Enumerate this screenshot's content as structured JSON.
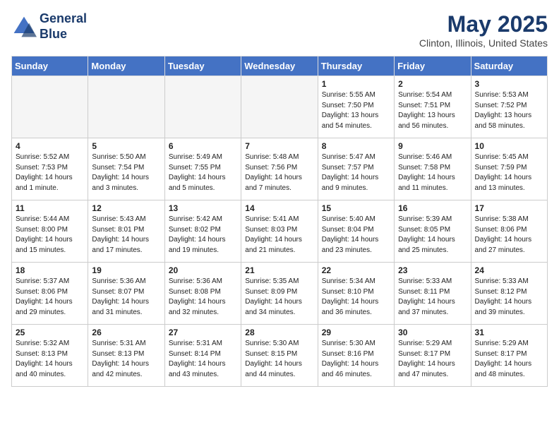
{
  "header": {
    "logo_line1": "General",
    "logo_line2": "Blue",
    "month_title": "May 2025",
    "location": "Clinton, Illinois, United States"
  },
  "days_of_week": [
    "Sunday",
    "Monday",
    "Tuesday",
    "Wednesday",
    "Thursday",
    "Friday",
    "Saturday"
  ],
  "weeks": [
    [
      {
        "day": "",
        "empty": true
      },
      {
        "day": "",
        "empty": true
      },
      {
        "day": "",
        "empty": true
      },
      {
        "day": "",
        "empty": true
      },
      {
        "day": "1",
        "sunrise": "Sunrise: 5:55 AM",
        "sunset": "Sunset: 7:50 PM",
        "daylight": "Daylight: 13 hours and 54 minutes."
      },
      {
        "day": "2",
        "sunrise": "Sunrise: 5:54 AM",
        "sunset": "Sunset: 7:51 PM",
        "daylight": "Daylight: 13 hours and 56 minutes."
      },
      {
        "day": "3",
        "sunrise": "Sunrise: 5:53 AM",
        "sunset": "Sunset: 7:52 PM",
        "daylight": "Daylight: 13 hours and 58 minutes."
      }
    ],
    [
      {
        "day": "4",
        "sunrise": "Sunrise: 5:52 AM",
        "sunset": "Sunset: 7:53 PM",
        "daylight": "Daylight: 14 hours and 1 minute."
      },
      {
        "day": "5",
        "sunrise": "Sunrise: 5:50 AM",
        "sunset": "Sunset: 7:54 PM",
        "daylight": "Daylight: 14 hours and 3 minutes."
      },
      {
        "day": "6",
        "sunrise": "Sunrise: 5:49 AM",
        "sunset": "Sunset: 7:55 PM",
        "daylight": "Daylight: 14 hours and 5 minutes."
      },
      {
        "day": "7",
        "sunrise": "Sunrise: 5:48 AM",
        "sunset": "Sunset: 7:56 PM",
        "daylight": "Daylight: 14 hours and 7 minutes."
      },
      {
        "day": "8",
        "sunrise": "Sunrise: 5:47 AM",
        "sunset": "Sunset: 7:57 PM",
        "daylight": "Daylight: 14 hours and 9 minutes."
      },
      {
        "day": "9",
        "sunrise": "Sunrise: 5:46 AM",
        "sunset": "Sunset: 7:58 PM",
        "daylight": "Daylight: 14 hours and 11 minutes."
      },
      {
        "day": "10",
        "sunrise": "Sunrise: 5:45 AM",
        "sunset": "Sunset: 7:59 PM",
        "daylight": "Daylight: 14 hours and 13 minutes."
      }
    ],
    [
      {
        "day": "11",
        "sunrise": "Sunrise: 5:44 AM",
        "sunset": "Sunset: 8:00 PM",
        "daylight": "Daylight: 14 hours and 15 minutes."
      },
      {
        "day": "12",
        "sunrise": "Sunrise: 5:43 AM",
        "sunset": "Sunset: 8:01 PM",
        "daylight": "Daylight: 14 hours and 17 minutes."
      },
      {
        "day": "13",
        "sunrise": "Sunrise: 5:42 AM",
        "sunset": "Sunset: 8:02 PM",
        "daylight": "Daylight: 14 hours and 19 minutes."
      },
      {
        "day": "14",
        "sunrise": "Sunrise: 5:41 AM",
        "sunset": "Sunset: 8:03 PM",
        "daylight": "Daylight: 14 hours and 21 minutes."
      },
      {
        "day": "15",
        "sunrise": "Sunrise: 5:40 AM",
        "sunset": "Sunset: 8:04 PM",
        "daylight": "Daylight: 14 hours and 23 minutes."
      },
      {
        "day": "16",
        "sunrise": "Sunrise: 5:39 AM",
        "sunset": "Sunset: 8:05 PM",
        "daylight": "Daylight: 14 hours and 25 minutes."
      },
      {
        "day": "17",
        "sunrise": "Sunrise: 5:38 AM",
        "sunset": "Sunset: 8:06 PM",
        "daylight": "Daylight: 14 hours and 27 minutes."
      }
    ],
    [
      {
        "day": "18",
        "sunrise": "Sunrise: 5:37 AM",
        "sunset": "Sunset: 8:06 PM",
        "daylight": "Daylight: 14 hours and 29 minutes."
      },
      {
        "day": "19",
        "sunrise": "Sunrise: 5:36 AM",
        "sunset": "Sunset: 8:07 PM",
        "daylight": "Daylight: 14 hours and 31 minutes."
      },
      {
        "day": "20",
        "sunrise": "Sunrise: 5:36 AM",
        "sunset": "Sunset: 8:08 PM",
        "daylight": "Daylight: 14 hours and 32 minutes."
      },
      {
        "day": "21",
        "sunrise": "Sunrise: 5:35 AM",
        "sunset": "Sunset: 8:09 PM",
        "daylight": "Daylight: 14 hours and 34 minutes."
      },
      {
        "day": "22",
        "sunrise": "Sunrise: 5:34 AM",
        "sunset": "Sunset: 8:10 PM",
        "daylight": "Daylight: 14 hours and 36 minutes."
      },
      {
        "day": "23",
        "sunrise": "Sunrise: 5:33 AM",
        "sunset": "Sunset: 8:11 PM",
        "daylight": "Daylight: 14 hours and 37 minutes."
      },
      {
        "day": "24",
        "sunrise": "Sunrise: 5:33 AM",
        "sunset": "Sunset: 8:12 PM",
        "daylight": "Daylight: 14 hours and 39 minutes."
      }
    ],
    [
      {
        "day": "25",
        "sunrise": "Sunrise: 5:32 AM",
        "sunset": "Sunset: 8:13 PM",
        "daylight": "Daylight: 14 hours and 40 minutes."
      },
      {
        "day": "26",
        "sunrise": "Sunrise: 5:31 AM",
        "sunset": "Sunset: 8:13 PM",
        "daylight": "Daylight: 14 hours and 42 minutes."
      },
      {
        "day": "27",
        "sunrise": "Sunrise: 5:31 AM",
        "sunset": "Sunset: 8:14 PM",
        "daylight": "Daylight: 14 hours and 43 minutes."
      },
      {
        "day": "28",
        "sunrise": "Sunrise: 5:30 AM",
        "sunset": "Sunset: 8:15 PM",
        "daylight": "Daylight: 14 hours and 44 minutes."
      },
      {
        "day": "29",
        "sunrise": "Sunrise: 5:30 AM",
        "sunset": "Sunset: 8:16 PM",
        "daylight": "Daylight: 14 hours and 46 minutes."
      },
      {
        "day": "30",
        "sunrise": "Sunrise: 5:29 AM",
        "sunset": "Sunset: 8:17 PM",
        "daylight": "Daylight: 14 hours and 47 minutes."
      },
      {
        "day": "31",
        "sunrise": "Sunrise: 5:29 AM",
        "sunset": "Sunset: 8:17 PM",
        "daylight": "Daylight: 14 hours and 48 minutes."
      }
    ]
  ]
}
